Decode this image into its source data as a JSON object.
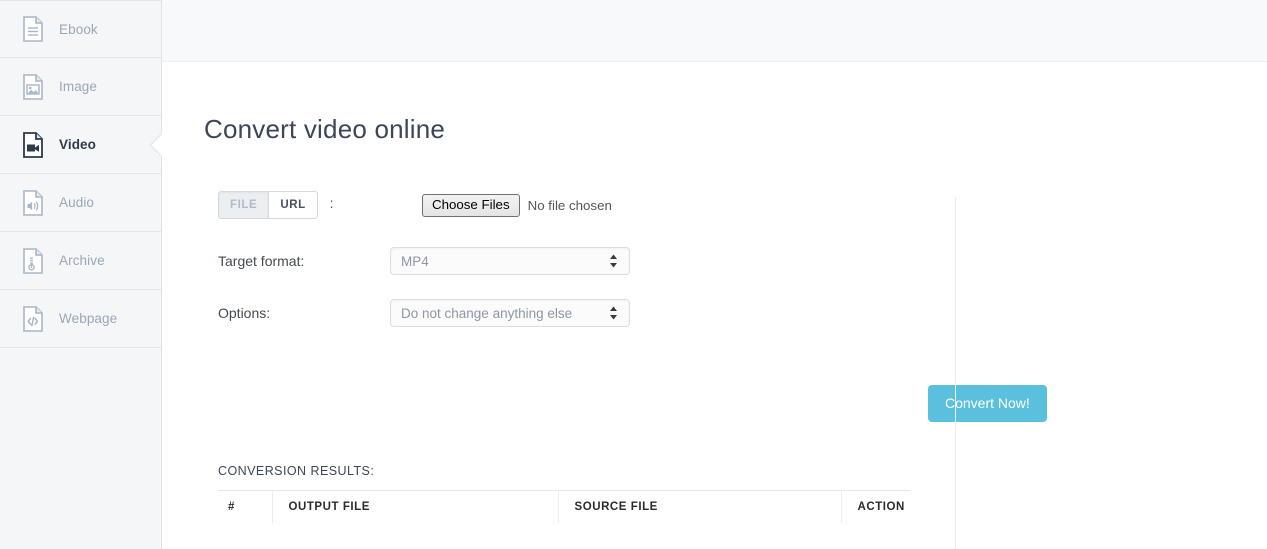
{
  "sidebar": {
    "items": [
      {
        "label": "Ebook",
        "icon": "ebook-file-icon",
        "active": false
      },
      {
        "label": "Image",
        "icon": "image-file-icon",
        "active": false
      },
      {
        "label": "Video",
        "icon": "video-file-icon",
        "active": true
      },
      {
        "label": "Audio",
        "icon": "audio-file-icon",
        "active": false
      },
      {
        "label": "Archive",
        "icon": "archive-file-icon",
        "active": false
      },
      {
        "label": "Webpage",
        "icon": "webpage-file-icon",
        "active": false
      }
    ]
  },
  "page": {
    "title": "Convert video online"
  },
  "form": {
    "source_toggle": {
      "file_label": "FILE",
      "url_label": "URL",
      "selected": "FILE",
      "colon": ":"
    },
    "file_input": {
      "button_label": "Choose Files",
      "status_text": "No file chosen"
    },
    "target_format": {
      "label": "Target format:",
      "value": "MP4"
    },
    "options": {
      "label": "Options:",
      "value": "Do not change anything else"
    },
    "convert_button": {
      "label": "Convert Now!",
      "color": "#5bc0de"
    }
  },
  "results": {
    "heading": "CONVERSION RESULTS:",
    "columns": [
      "#",
      "OUTPUT FILE",
      "SOURCE FILE",
      "ACTION"
    ],
    "rows": []
  },
  "colors": {
    "sidebar_bg": "#f5f6f7",
    "topbar_bg": "#f8f9fa",
    "accent": "#5bc0de",
    "text_muted": "#9aa7b8",
    "text_dark": "#3b4656"
  }
}
